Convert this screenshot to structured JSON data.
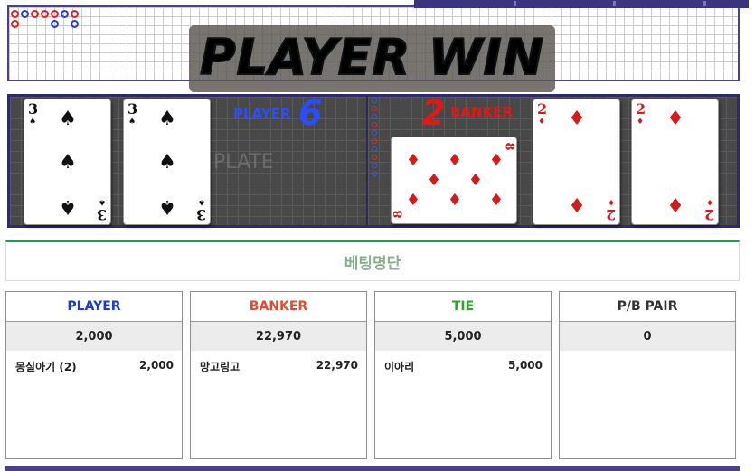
{
  "banner": {
    "text": "PLAYER WIN"
  },
  "table": {
    "watermark": "PLATE",
    "player": {
      "label": "PLAYER",
      "score": "6"
    },
    "banker": {
      "label": "BANKER",
      "score": "2"
    },
    "player_cards": [
      {
        "rank": "3",
        "suit": "♠",
        "color": "black"
      },
      {
        "rank": "3",
        "suit": "♠",
        "color": "black"
      }
    ],
    "banker_cards": [
      {
        "rank": "8",
        "suit": "♦",
        "color": "red"
      },
      {
        "rank": "2",
        "suit": "♦",
        "color": "red"
      },
      {
        "rank": "2",
        "suit": "♦",
        "color": "red"
      }
    ]
  },
  "bets": {
    "title": "베팅명단",
    "columns": [
      {
        "label": "PLAYER",
        "color": "#1a3ad0",
        "total": "2,000",
        "entries": [
          {
            "name": "몽실아기 (2)",
            "amount": "2,000"
          }
        ]
      },
      {
        "label": "BANKER",
        "color": "#e04b32",
        "total": "22,970",
        "entries": [
          {
            "name": "망고링고",
            "amount": "22,970"
          }
        ]
      },
      {
        "label": "TIE",
        "color": "#2ea52e",
        "total": "5,000",
        "entries": [
          {
            "name": "이아리",
            "amount": "5,000"
          }
        ]
      },
      {
        "label": "P/B PAIR",
        "color": "#333333",
        "total": "0",
        "entries": []
      }
    ]
  },
  "icons": {
    "card_suits": [
      "spade-icon",
      "diamond-icon"
    ]
  }
}
